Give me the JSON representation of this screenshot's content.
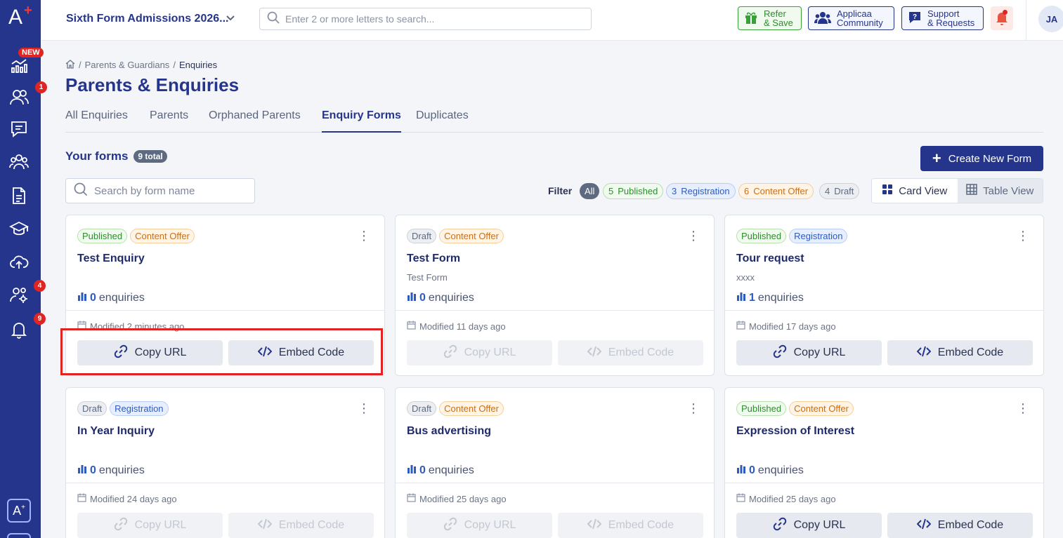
{
  "sidebar": {
    "logo": "A",
    "new_badge": "NEW",
    "badges": {
      "people": "1",
      "settings": "4",
      "notifications": "9"
    },
    "items": [
      "analytics-icon",
      "people-icon",
      "messages-icon",
      "groups-icon",
      "document-icon",
      "graduation-icon",
      "upload-icon",
      "settings-users-icon",
      "bell-icon"
    ]
  },
  "topbar": {
    "school_name": "Sixth Form Admissions 2026...",
    "search_placeholder": "Enter 2 or more letters to search...",
    "refer": {
      "line1": "Refer",
      "line2": "& Save"
    },
    "community": {
      "line1": "Applicaa",
      "line2": "Community"
    },
    "support": {
      "line1": "Support",
      "line2": "& Requests"
    },
    "avatar_initials": "JA"
  },
  "breadcrumb": {
    "parent": "Parents & Guardians",
    "current": "Enquiries"
  },
  "page_title": "Parents & Enquiries",
  "tabs": [
    {
      "label": "All Enquiries",
      "active": false
    },
    {
      "label": "Parents",
      "active": false
    },
    {
      "label": "Orphaned Parents",
      "active": false
    },
    {
      "label": "Enquiry Forms",
      "active": true
    },
    {
      "label": "Duplicates",
      "active": false
    }
  ],
  "forms_header": {
    "title": "Your forms",
    "total": "9 total"
  },
  "create_button": "Create New Form",
  "form_search_placeholder": "Search by form name",
  "filter": {
    "label": "Filter",
    "all": "All",
    "published": {
      "count": "5",
      "label": "Published"
    },
    "registration": {
      "count": "3",
      "label": "Registration"
    },
    "content_offer": {
      "count": "6",
      "label": "Content Offer"
    },
    "draft": {
      "count": "4",
      "label": "Draft"
    }
  },
  "views": {
    "card": "Card View",
    "table": "Table View"
  },
  "card_labels": {
    "enquiries": "enquiries",
    "copy_url": "Copy URL",
    "embed_code": "Embed Code"
  },
  "cards": [
    {
      "tags": [
        "Published",
        "Content Offer"
      ],
      "name": "Test Enquiry",
      "description": "",
      "enquiries": "0",
      "modified": "Modified 2 minutes ago"
    },
    {
      "tags": [
        "Draft",
        "Content Offer"
      ],
      "name": "Test Form",
      "description": "Test Form",
      "enquiries": "0",
      "modified": "Modified 11 days ago"
    },
    {
      "tags": [
        "Published",
        "Registration"
      ],
      "name": "Tour request",
      "description": "xxxx",
      "enquiries": "1",
      "modified": "Modified 17 days ago"
    },
    {
      "tags": [
        "Draft",
        "Registration"
      ],
      "name": "In Year Inquiry",
      "description": "",
      "enquiries": "0",
      "modified": "Modified 24 days ago"
    },
    {
      "tags": [
        "Draft",
        "Content Offer"
      ],
      "name": "Bus advertising",
      "description": "",
      "enquiries": "0",
      "modified": "Modified 25 days ago"
    },
    {
      "tags": [
        "Published",
        "Content Offer"
      ],
      "name": "Expression of Interest",
      "description": "",
      "enquiries": "0",
      "modified": "Modified 25 days ago"
    }
  ],
  "colors": {
    "brand": "#26358c",
    "highlight": "#e02424"
  }
}
